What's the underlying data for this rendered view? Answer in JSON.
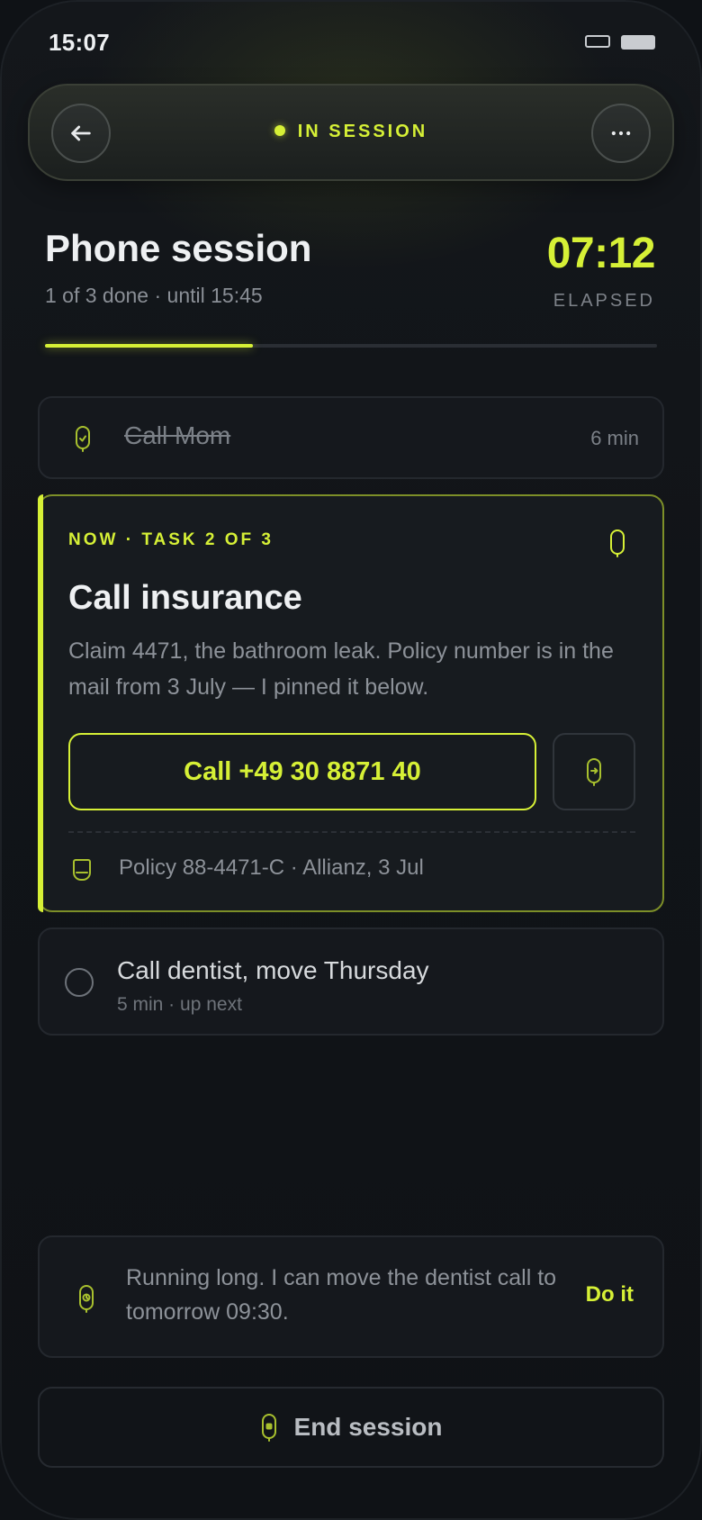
{
  "status_bar": {
    "time": "15:07"
  },
  "header": {
    "session_state": "IN SESSION",
    "back_icon": "arrow-left-icon",
    "more_icon": "more-horizontal-icon"
  },
  "session": {
    "title": "Phone session",
    "subtitle": "1 of 3 done · until 15:45",
    "timer": "07:12",
    "timer_label": "ELAPSED",
    "progress": 0.34
  },
  "tasks": [
    {
      "name": "Call Mom",
      "duration": "6 min",
      "state": "done",
      "icon": "phone-check-icon"
    },
    {
      "kicker": "NOW · TASK 2 OF 3",
      "name": "Call insurance",
      "description": "Claim 4471, the bathroom leak. Policy number is in the mail from 3 July — I pinned it below.",
      "call_label": "Call +49 30 8871 40",
      "pinned_note": "Policy 88-4471-C · Allianz, 3 Jul",
      "state": "current",
      "icon": "phone-icon"
    },
    {
      "name": "Call dentist, move Thursday",
      "meta": "5 min · up next",
      "state": "pending"
    }
  ],
  "suggestion": {
    "text": "Running long. I can move the dentist call to tomorrow 09:30.",
    "action": "Do it",
    "icon": "clock-phone-icon"
  },
  "footer": {
    "end_label": "End session",
    "icon": "stop-phone-icon"
  },
  "colors": {
    "accent": "#d6f036",
    "background": "#0f1216",
    "card": "#15181d",
    "muted_text": "#8d9299"
  }
}
